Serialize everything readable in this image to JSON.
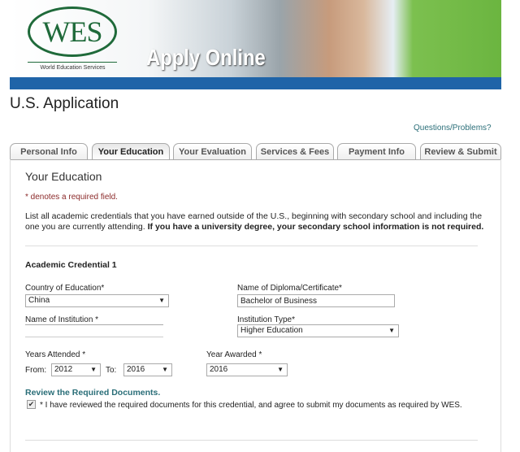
{
  "banner": {
    "logo_text": "WES",
    "logo_subtitle": "World Education Services",
    "tagline": "Apply Online",
    "colors": {
      "bar": "#1f64a8",
      "logo": "#1f6a3a"
    }
  },
  "page_title": "U.S. Application",
  "help_link": "Questions/Problems?",
  "tabs": [
    {
      "label": "Personal Info"
    },
    {
      "label": "Your Education",
      "active": true
    },
    {
      "label": "Your Evaluation"
    },
    {
      "label": "Services & Fees"
    },
    {
      "label": "Payment Info"
    },
    {
      "label": "Review & Submit"
    }
  ],
  "section": {
    "title": "Your Education",
    "required_note": "* denotes a required field.",
    "intro": "List all academic credentials that you have earned outside of the U.S., beginning with secondary school and including the one you are currently attending.",
    "intro_bold": "If you have a university degree, your secondary school information is not required.",
    "credential_title": "Academic Credential 1",
    "fields": {
      "country_label": "Country of Education*",
      "country_value": "China",
      "diploma_label": "Name of Diploma/Certificate*",
      "diploma_value": "Bachelor of Business",
      "institution_label": "Name of Institution *",
      "institution_value": "",
      "type_label": "Institution Type*",
      "type_value": "Higher Education",
      "years_label": "Years Attended *",
      "from_label": "From:",
      "from_value": "2012",
      "to_label": "To:",
      "to_value": "2016",
      "awarded_label": "Year Awarded *",
      "awarded_value": "2016"
    },
    "review_link": "Review the Required Documents.",
    "agree_text": "* I have reviewed the required documents for this credential, and agree to submit my documents as required by WES.",
    "agree_checked": true
  }
}
